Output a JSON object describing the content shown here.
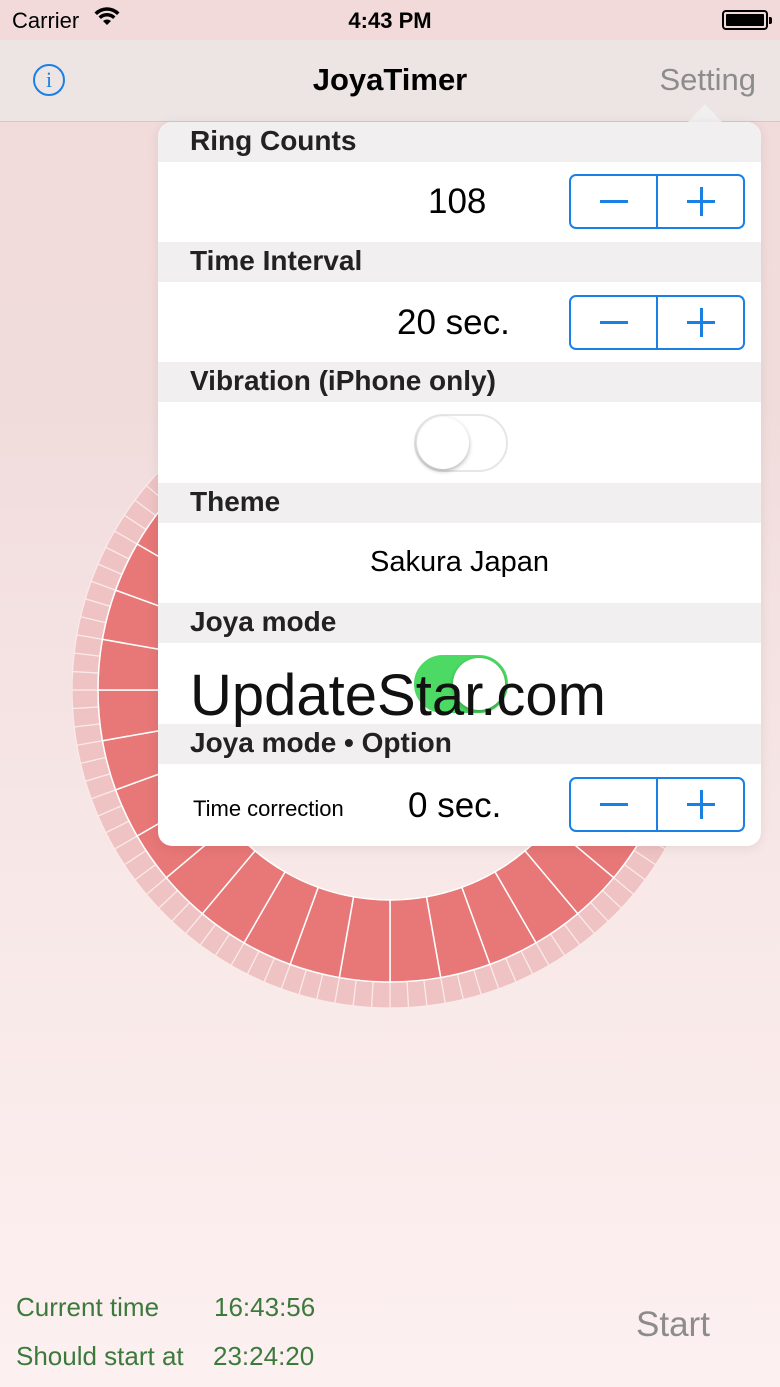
{
  "status_bar": {
    "carrier": "Carrier",
    "time": "4:43 PM"
  },
  "nav": {
    "info_icon": "info-icon",
    "title": "JoyaTimer",
    "setting": "Setting"
  },
  "settings": {
    "ring_counts": {
      "label": "Ring Counts",
      "value": "108"
    },
    "time_interval": {
      "label": "Time Interval",
      "value": "20 sec."
    },
    "vibration": {
      "label": "Vibration (iPhone only)",
      "on": false
    },
    "theme": {
      "label": "Theme",
      "value": "Sakura Japan"
    },
    "joya_mode": {
      "label": "Joya mode",
      "on": true
    },
    "joya_option": {
      "label": "Joya mode • Option",
      "sub_label": "Time correction",
      "value": "0 sec."
    }
  },
  "watermark": "UpdateStar.com",
  "footer": {
    "current_label": "Current time",
    "current_time": "16:43:56",
    "start_label": "Should start at",
    "start_time": "23:24:20",
    "start_button": "Start"
  },
  "colors": {
    "accent": "#1a80e6",
    "toggle_on": "#4cd964",
    "dial_inner": "#e87777",
    "dial_outer": "#efc3c3",
    "footer_text": "#3c7a3c"
  }
}
